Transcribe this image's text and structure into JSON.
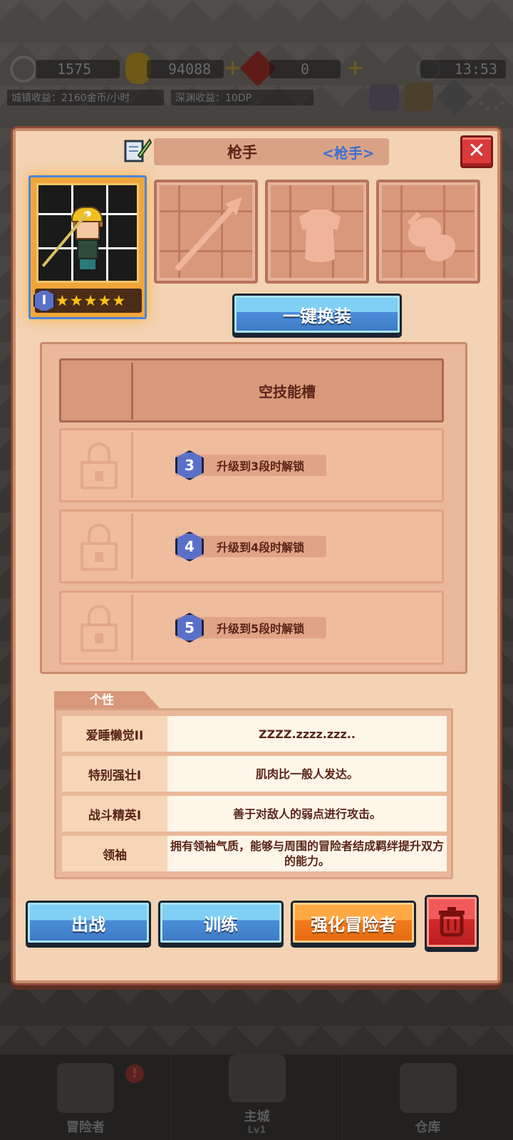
{
  "topbar": {
    "energy": "1575",
    "gold": "94088",
    "gems": "0",
    "clock": "13:53",
    "town_income": "城镇收益：2160金币/小时",
    "abyss_income": "深渊收益：10DP"
  },
  "dialog": {
    "name": "枪手",
    "class_tag": "<枪手>",
    "close_glyph": "✕",
    "rank": "I",
    "stars": [
      "★",
      "★",
      "★",
      "★",
      "★"
    ],
    "auto_equip_label": "一键换装"
  },
  "skills": {
    "empty_label": "空技能槽",
    "locked": [
      {
        "level": "3",
        "text": "升级到3段时解锁"
      },
      {
        "level": "4",
        "text": "升级到4段时解锁"
      },
      {
        "level": "5",
        "text": "升级到5段时解锁"
      }
    ]
  },
  "traits": {
    "header": "个性",
    "items": [
      {
        "name": "爱睡懒觉II",
        "desc": "ZZZZ.zzzz.zzz.."
      },
      {
        "name": "特别强壮I",
        "desc": "肌肉比一般人发达。"
      },
      {
        "name": "战斗精英I",
        "desc": "善于对敌人的弱点进行攻击。"
      },
      {
        "name": "领袖",
        "desc": "拥有领袖气质，能够与周围的冒险者结成羁绊提升双方的能力。"
      }
    ]
  },
  "actions": {
    "deploy": "出战",
    "train": "训练",
    "enhance": "强化冒险者"
  },
  "nav": {
    "adventurers": "冒险者",
    "badge": "!",
    "castle": "主城",
    "castle_level": "Lv1",
    "warehouse": "仓库"
  },
  "colors": {
    "panel_bg": "#f3d3b3",
    "accent_blue": "#4a8ed8",
    "accent_orange": "#f27a1a",
    "danger_red": "#d22a2a",
    "class_blue": "#3b6fd2"
  }
}
